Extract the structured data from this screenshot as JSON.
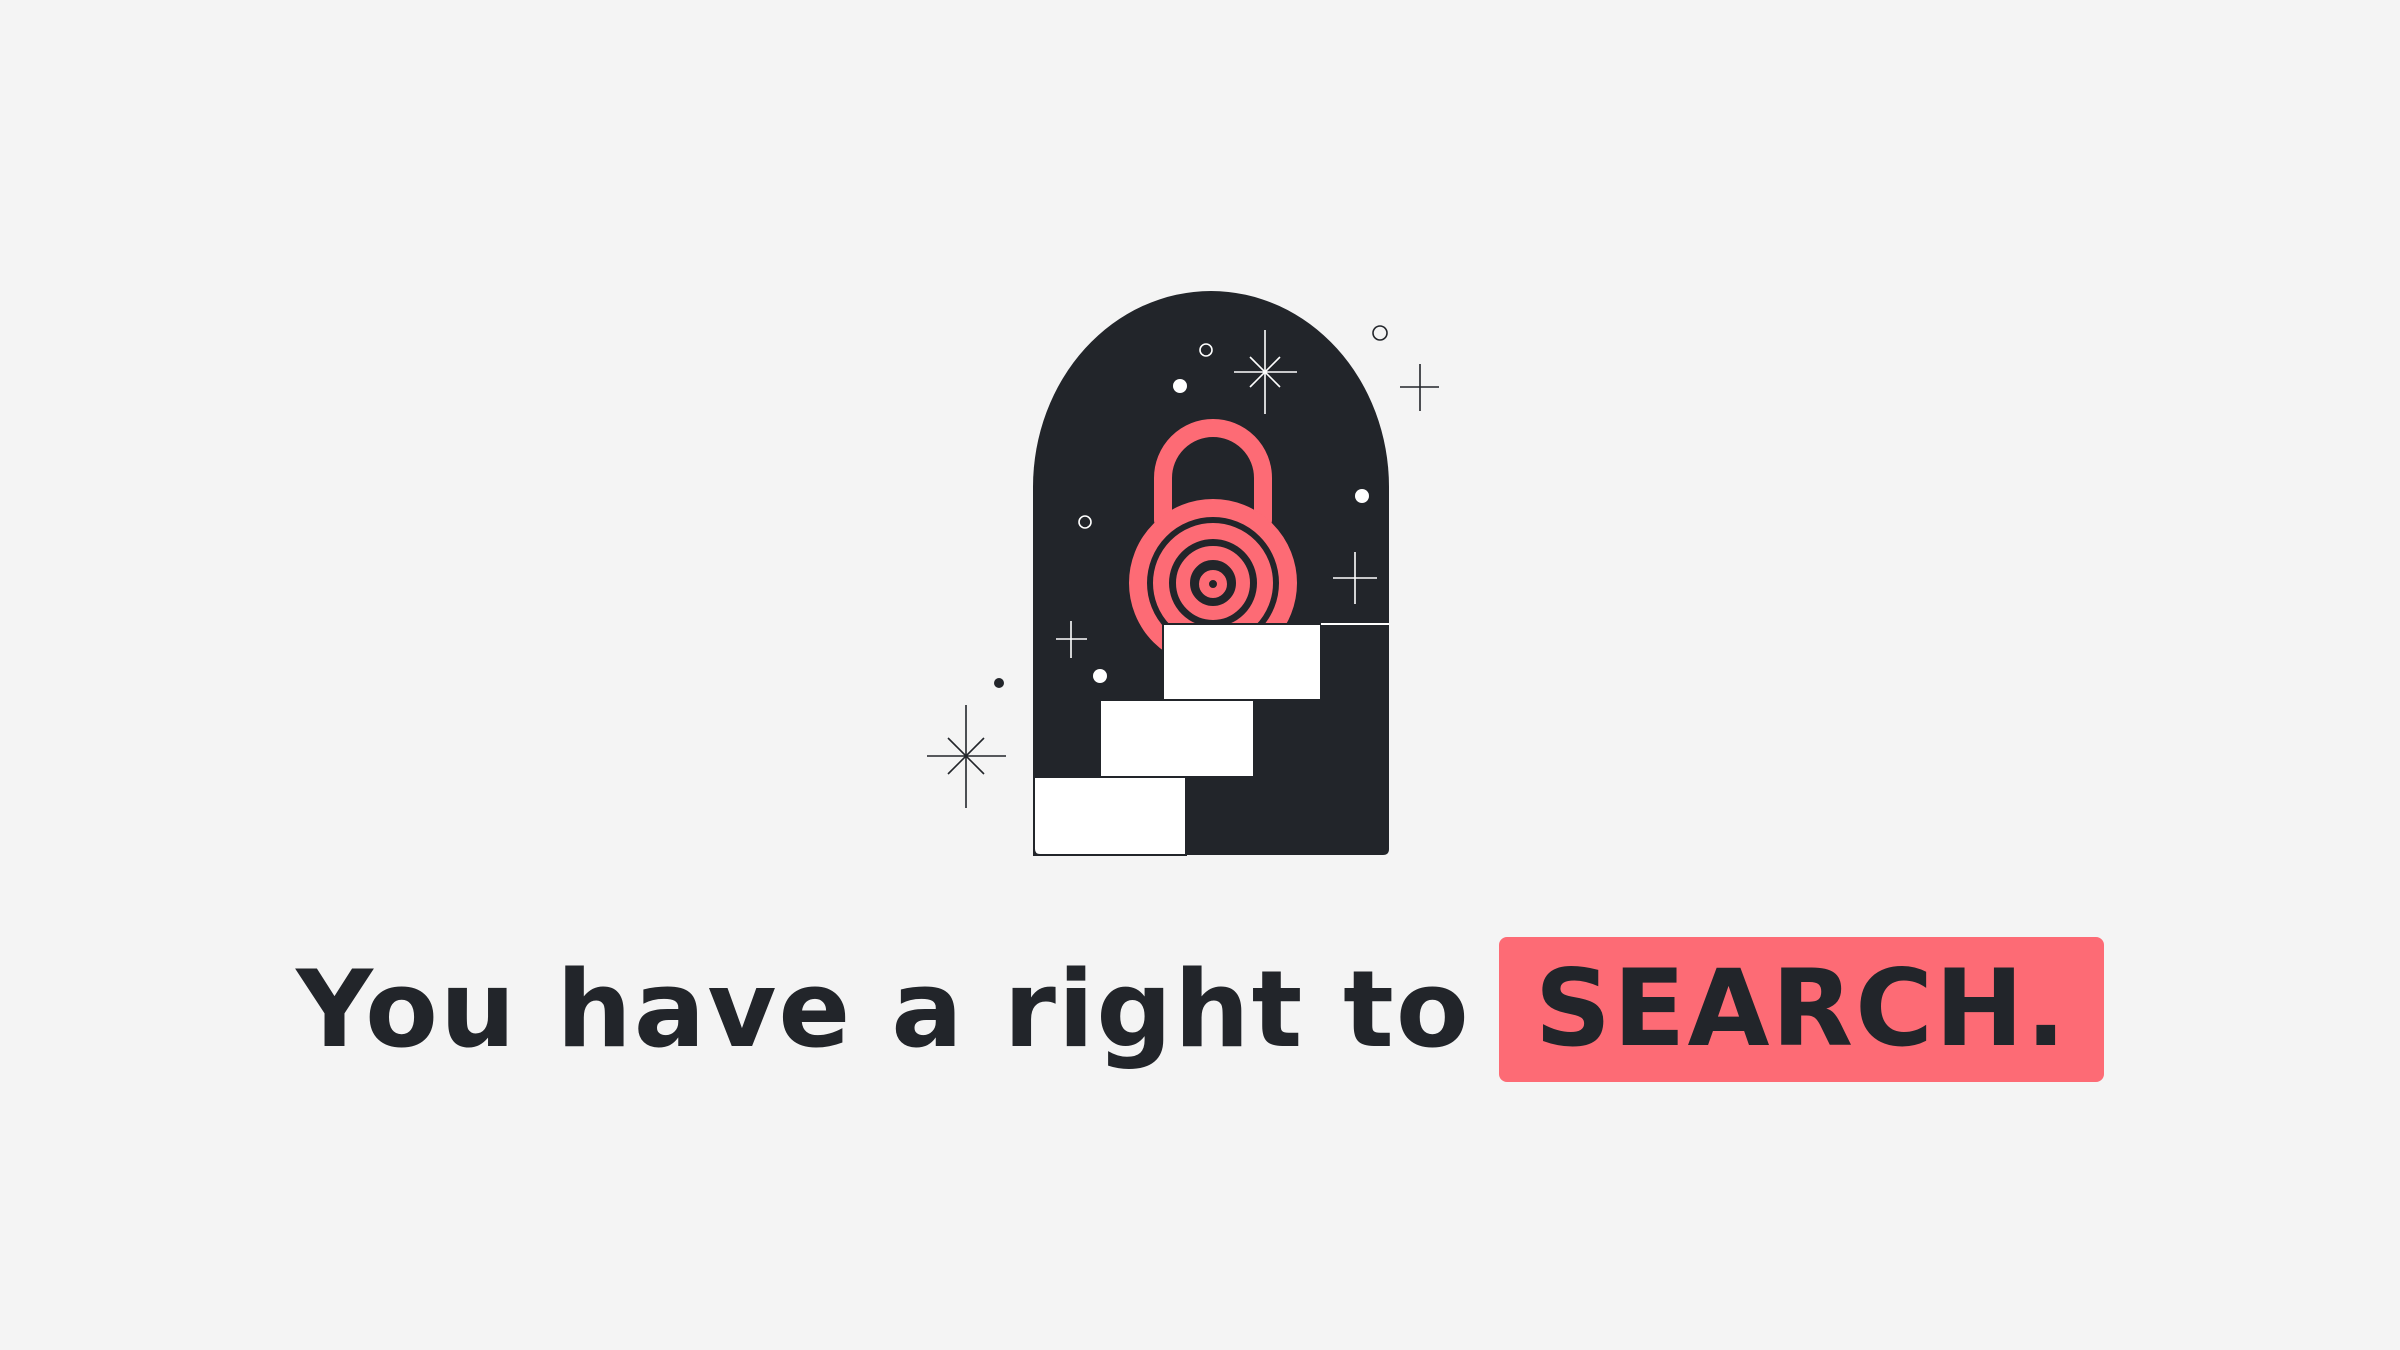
{
  "headline": {
    "lead": "You have a right to",
    "highlight": "SEARCH."
  },
  "illustration": {
    "icons": [
      "padlock-icon",
      "staircase",
      "sparkle-icon",
      "star-dot"
    ]
  },
  "colors": {
    "background": "#f4f4f4",
    "dark": "#22252a",
    "accent": "#fd6b75",
    "white": "#ffffff"
  }
}
